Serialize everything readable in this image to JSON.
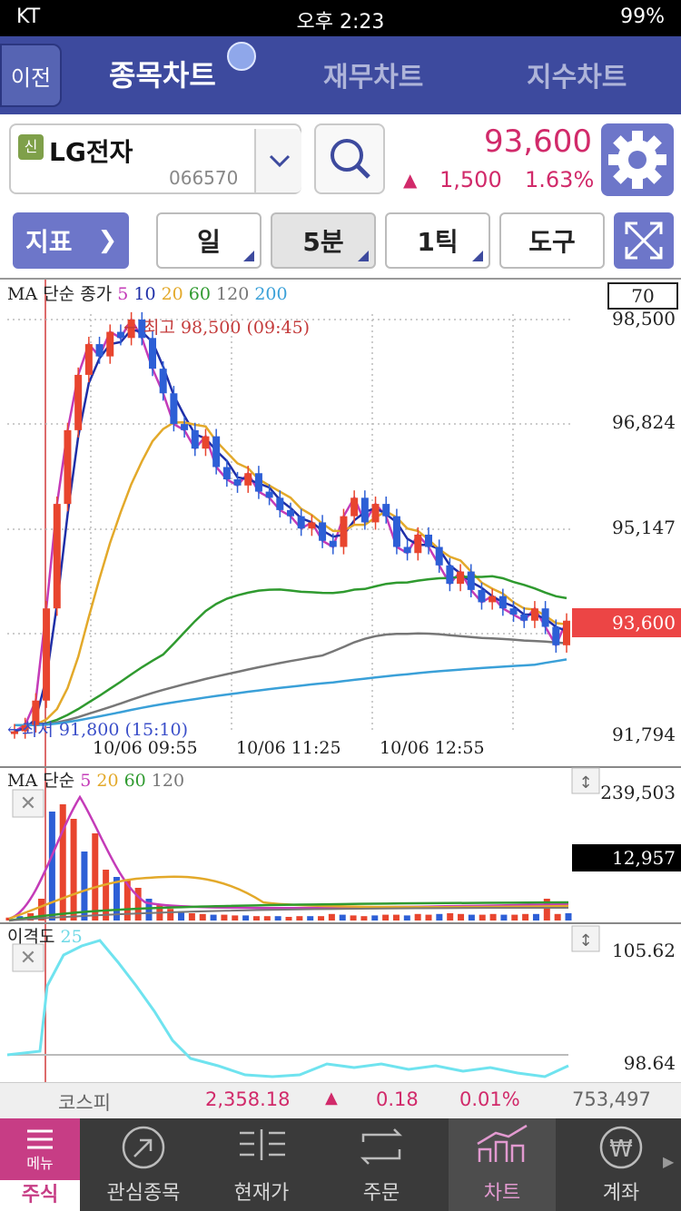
{
  "status": {
    "carrier": "KT",
    "time": "오후 2:23",
    "battery": "99%"
  },
  "header": {
    "back": "이전",
    "tabs": [
      "종목차트",
      "재무차트",
      "지수차트"
    ],
    "active_tab": 0
  },
  "stock": {
    "badge": "신",
    "name": "LG전자",
    "code": "066570",
    "price": "93,600",
    "change": "1,500",
    "change_pct": "1.63%",
    "direction": "▲"
  },
  "toolbar": {
    "indicator": "지표",
    "period": "일",
    "interval": "5분",
    "tick": "1틱",
    "tools": "도구"
  },
  "price_chart": {
    "legend_prefix": "MA 단순 종가",
    "ma_periods": [
      "5",
      "10",
      "20",
      "60",
      "120",
      "200"
    ],
    "ma_colors": [
      "#c43bb8",
      "#1f2fa8",
      "#e3a92a",
      "#2f9a2f",
      "#777777",
      "#3aa0d8"
    ],
    "box_value": "70",
    "y_ticks": [
      "98,500",
      "96,824",
      "95,147",
      "91,794"
    ],
    "current_price": "93,600",
    "high_label": "최고 98,500 (09:45)",
    "low_label": "최저 91,800 (15:10)",
    "x_ticks": [
      "10/06 09:55",
      "10/06 11:25",
      "10/06 12:55"
    ]
  },
  "volume_chart": {
    "legend": "MA 단순",
    "periods": [
      "5",
      "20",
      "60",
      "120"
    ],
    "colors": [
      "#c43bb8",
      "#e3a92a",
      "#2f9a2f",
      "#777777"
    ],
    "y_top": "239,503",
    "current": "12,957"
  },
  "disparity_chart": {
    "legend": "이격도",
    "period": "25",
    "y_top": "105.62",
    "y_bottom": "98.64"
  },
  "kospi": {
    "name": "코스피",
    "value": "2,358.18",
    "dir": "▲",
    "change": "0.18",
    "pct": "0.01%",
    "volume": "753,497"
  },
  "tabbar": {
    "items": [
      "주식",
      "관심종목",
      "현재가",
      "주문",
      "차트",
      "계좌"
    ],
    "menu": "메뉴",
    "active": 4
  },
  "chart_data": {
    "type": "candlestick",
    "y_axis_labels": [
      "98,500",
      "96,824",
      "95,147",
      "91,794"
    ],
    "x_axis_labels": [
      "10/06 09:55",
      "10/06 11:25",
      "10/06 12:55"
    ],
    "high": 98500,
    "low": 91800,
    "current": 93600,
    "close_series": [
      91800,
      91900,
      92300,
      93800,
      95500,
      96700,
      97600,
      98100,
      97900,
      98300,
      98200,
      98500,
      98200,
      97700,
      97300,
      96800,
      96700,
      96400,
      96600,
      96100,
      95900,
      95800,
      96000,
      95700,
      95600,
      95400,
      95300,
      95100,
      95200,
      94900,
      94800,
      95300,
      95600,
      95200,
      95500,
      95300,
      94800,
      94700,
      95000,
      94800,
      94500,
      94200,
      94400,
      94100,
      93900,
      94000,
      93800,
      93700,
      93600,
      93800,
      93500,
      93200,
      93600
    ]
  }
}
